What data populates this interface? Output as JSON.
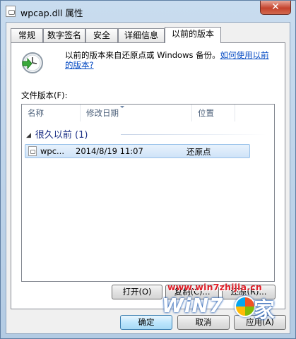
{
  "window": {
    "title": "wpcap.dll 属性",
    "close_glyph": "✕"
  },
  "tabs": [
    {
      "label": "常规"
    },
    {
      "label": "数字签名"
    },
    {
      "label": "安全"
    },
    {
      "label": "详细信息"
    },
    {
      "label": "以前的版本"
    }
  ],
  "intro": {
    "text": "以前的版本来自还原点或 Windows 备份。",
    "link": "如何使用以前的版本?"
  },
  "file_versions_label": "文件版本(F):",
  "columns": {
    "name": "名称",
    "date": "修改日期",
    "location": "位置"
  },
  "group": {
    "label": "很久以前 (1)"
  },
  "rows": [
    {
      "name": "wpc...",
      "date": "2014/8/19 11:07",
      "location": "还原点"
    }
  ],
  "panel_buttons": {
    "open": "打开(O)",
    "copy": "复制(C)...",
    "restore": "还原(R)..."
  },
  "footer_buttons": {
    "ok": "确定",
    "cancel": "取消",
    "apply": "应用(A)"
  },
  "watermark": {
    "url": "www.win7zhijia.cn",
    "logo": "WiN7",
    "suffix": "家"
  }
}
